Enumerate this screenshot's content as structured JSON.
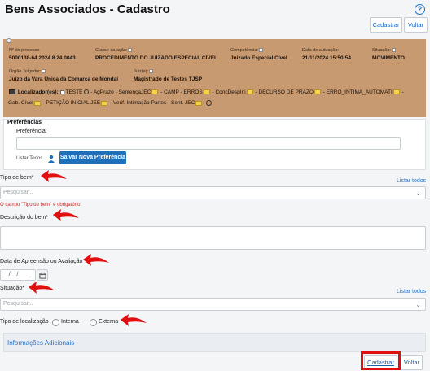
{
  "page": {
    "title": "Bens Associados - Cadastro"
  },
  "toolbar": {
    "cadastrar": "Cadastrar",
    "voltar": "Voltar"
  },
  "process": {
    "numero_label": "Nº do processo",
    "numero_value": "5000138-64.2024.8.24.0043",
    "classe_label": "Classe da ação:",
    "classe_value": "PROCEDIMENTO DO JUIZADO ESPECIAL CÍVEL",
    "competencia_label": "Competência:",
    "competencia_value": "Juizado Especial Cível",
    "autuacao_label": "Data de autuação:",
    "autuacao_value": "21/11/2024 15:50:54",
    "situacao_label": "Situação:",
    "situacao_value": "MOVIMENTO",
    "orgao_label": "Órgão Julgador:",
    "orgao_value": "Juízo da Vara Única da Comarca de Mondaí",
    "juiz_label": "Juiz(a):",
    "juiz_value": "Magistrado de Testes TJSP",
    "localizadores_label": "Localizador(es):",
    "loc_teste": "TESTE",
    "loc_agprazo": "- AgPrazo - SentençaJEC",
    "loc_camp": "- CAMP - ERROS",
    "loc_concdesp": "- ConcDespIni",
    "loc_decurso": "- DECURSO DE PRAZO",
    "loc_erro": "- ERRO_INTIMA_AUTOMATI",
    "loc_dash": "-",
    "loc_gab": "Gab. Cível",
    "loc_peticao": "- PETIÇÃO INICIAL JEE",
    "loc_verif": "- Verif. Intimação Partes - Sent. JEC"
  },
  "preferencias": {
    "title": "Preferências",
    "label": "Preferência:",
    "value": "",
    "listar_todos": "Listar Todos",
    "salvar_button": "Salvar Nova Preferência"
  },
  "form": {
    "tipo_bem_label": "Tipo de bem*",
    "tipo_bem_listar": "Listar todos",
    "tipo_bem_placeholder": "Pesquisar...",
    "tipo_bem_error": "O campo \"Tipo de bem\" é obrigatório",
    "descricao_label": "Descrição do bem*",
    "descricao_value": "",
    "data_label": "Data de Apreensão ou Avaliação",
    "data_placeholder": "__/__/____",
    "situacao_label": "Situação*",
    "situacao_listar": "Listar todos",
    "situacao_placeholder": "Pesquisar...",
    "tipo_localizacao_label": "Tipo de localização",
    "opcao_interna": "Interna",
    "opcao_externa": "Externa"
  },
  "info_adicionais": {
    "title": "Informações Adicionais"
  },
  "colors": {
    "accent": "#1e6fb8",
    "process_bg": "#c89a72",
    "arrow": "#e01010",
    "error": "#d42a2a"
  }
}
